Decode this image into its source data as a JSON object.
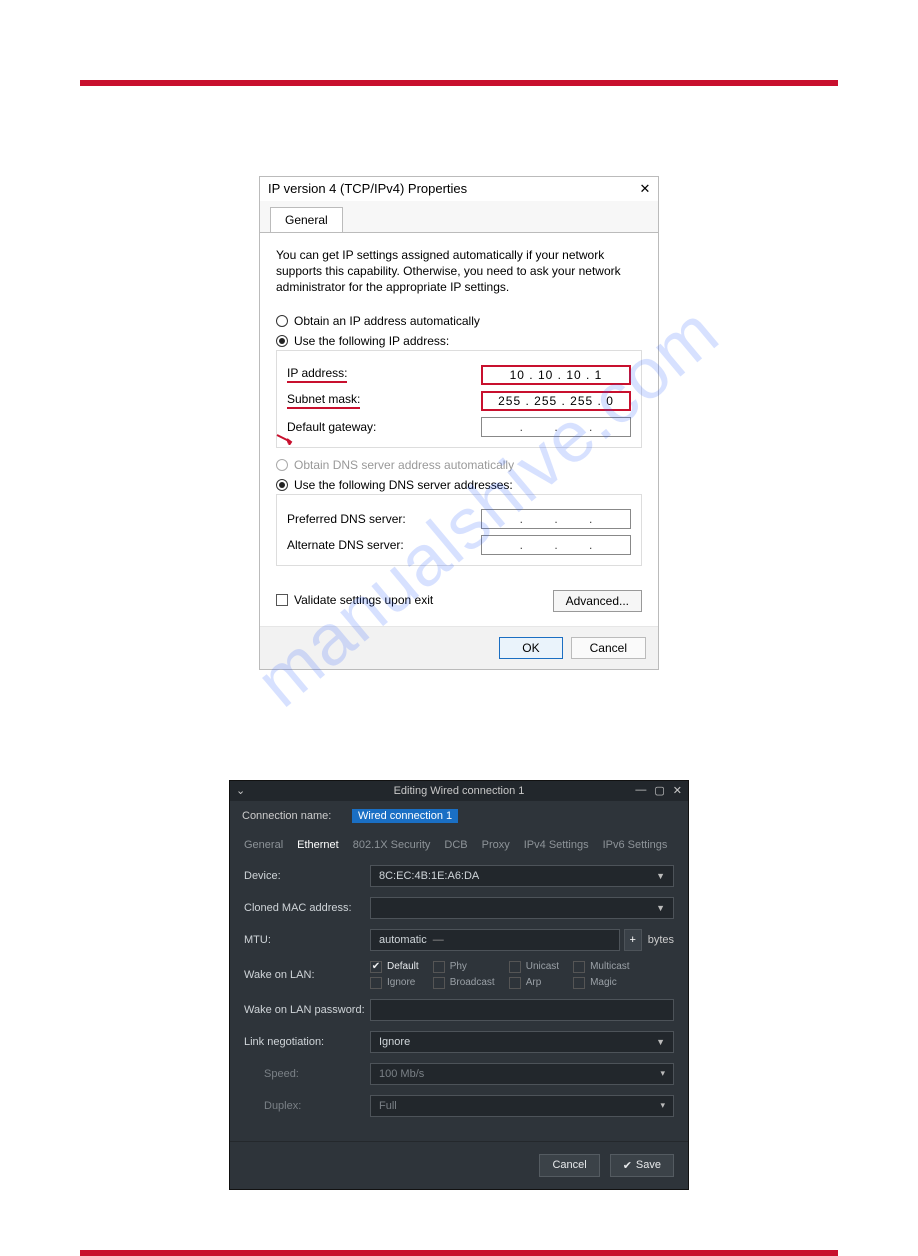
{
  "watermark": "manualshive.com",
  "win": {
    "title": "IP version 4 (TCP/IPv4) Properties",
    "tab": "General",
    "desc": "You can get IP settings assigned automatically if your network supports this capability. Otherwise, you need to ask your network administrator for the appropriate IP settings.",
    "opt_auto_ip": "Obtain an IP address automatically",
    "opt_use_ip": "Use the following IP address:",
    "lbl_ip": "IP address:",
    "val_ip": "10  .  10  .  10  .   1",
    "lbl_mask": "Subnet mask:",
    "val_mask": "255 . 255 . 255 .   0",
    "lbl_gw": "Default gateway:",
    "val_gw": ".     .     .",
    "opt_auto_dns": "Obtain DNS server address automatically",
    "opt_use_dns": "Use the following DNS server addresses:",
    "lbl_pref": "Preferred DNS server:",
    "val_pref": ".     .     .",
    "lbl_alt": "Alternate DNS server:",
    "val_alt": ".     .     .",
    "chk_validate": "Validate settings upon exit",
    "btn_adv": "Advanced...",
    "btn_ok": "OK",
    "btn_cancel": "Cancel"
  },
  "dark": {
    "title": "Editing Wired connection 1",
    "conn_label": "Connection name:",
    "conn_value": "Wired connection 1",
    "tabs": [
      "General",
      "Ethernet",
      "802.1X Security",
      "DCB",
      "Proxy",
      "IPv4 Settings",
      "IPv6 Settings"
    ],
    "lbl_device": "Device:",
    "val_device": "8C:EC:4B:1E:A6:DA",
    "lbl_cloned": "Cloned MAC address:",
    "val_cloned": "",
    "lbl_mtu": "MTU:",
    "val_mtu": "automatic",
    "bytes": "bytes",
    "lbl_wol": "Wake on LAN:",
    "wol": {
      "default": "Default",
      "phy": "Phy",
      "unicast": "Unicast",
      "multicast": "Multicast",
      "ignore": "Ignore",
      "broadcast": "Broadcast",
      "arp": "Arp",
      "magic": "Magic"
    },
    "lbl_wolpw": "Wake on LAN password:",
    "lbl_link": "Link negotiation:",
    "val_link": "Ignore",
    "lbl_speed": "Speed:",
    "val_speed": "100 Mb/s",
    "lbl_duplex": "Duplex:",
    "val_duplex": "Full",
    "btn_cancel": "Cancel",
    "btn_save": "Save"
  }
}
